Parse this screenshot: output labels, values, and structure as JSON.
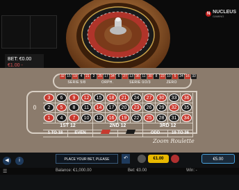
{
  "logo": {
    "name": "NUCLEUS",
    "sub": "GAMING"
  },
  "bet_panel": {
    "bet": "BET: €0.00",
    "limits": "€1.00 - €100.00"
  },
  "racetrack": {
    "numbers": [
      {
        "n": "32",
        "c": "red"
      },
      {
        "n": "15",
        "c": "black"
      },
      {
        "n": "19",
        "c": "red"
      },
      {
        "n": "4",
        "c": "black"
      },
      {
        "n": "21",
        "c": "red"
      },
      {
        "n": "2",
        "c": "black"
      },
      {
        "n": "25",
        "c": "red"
      },
      {
        "n": "17",
        "c": "black"
      },
      {
        "n": "34",
        "c": "red"
      },
      {
        "n": "6",
        "c": "black"
      },
      {
        "n": "27",
        "c": "red"
      },
      {
        "n": "13",
        "c": "black"
      },
      {
        "n": "36",
        "c": "red"
      },
      {
        "n": "11",
        "c": "black"
      },
      {
        "n": "30",
        "c": "red"
      },
      {
        "n": "8",
        "c": "black"
      },
      {
        "n": "23",
        "c": "red"
      },
      {
        "n": "10",
        "c": "black"
      },
      {
        "n": "5",
        "c": "red"
      },
      {
        "n": "24",
        "c": "black"
      },
      {
        "n": "16",
        "c": "red"
      },
      {
        "n": "33",
        "c": "black"
      }
    ],
    "sectors": [
      "SERIE 5/8",
      "ORPH.",
      "SERIE 0/2/3",
      "ZERO"
    ]
  },
  "table": {
    "zero": "0",
    "rows": [
      [
        {
          "n": "3",
          "c": "red"
        },
        {
          "n": "6",
          "c": "black"
        },
        {
          "n": "9",
          "c": "red"
        },
        {
          "n": "12",
          "c": "red"
        },
        {
          "n": "15",
          "c": "black"
        },
        {
          "n": "18",
          "c": "red"
        },
        {
          "n": "21",
          "c": "red"
        },
        {
          "n": "24",
          "c": "black"
        },
        {
          "n": "27",
          "c": "red"
        },
        {
          "n": "30",
          "c": "red"
        },
        {
          "n": "33",
          "c": "black"
        },
        {
          "n": "36",
          "c": "red"
        }
      ],
      [
        {
          "n": "2",
          "c": "black"
        },
        {
          "n": "5",
          "c": "red"
        },
        {
          "n": "8",
          "c": "black"
        },
        {
          "n": "11",
          "c": "black"
        },
        {
          "n": "14",
          "c": "red"
        },
        {
          "n": "17",
          "c": "black"
        },
        {
          "n": "20",
          "c": "black"
        },
        {
          "n": "23",
          "c": "red"
        },
        {
          "n": "26",
          "c": "black"
        },
        {
          "n": "29",
          "c": "black"
        },
        {
          "n": "32",
          "c": "red"
        },
        {
          "n": "35",
          "c": "black"
        }
      ],
      [
        {
          "n": "1",
          "c": "red"
        },
        {
          "n": "4",
          "c": "black"
        },
        {
          "n": "7",
          "c": "red"
        },
        {
          "n": "10",
          "c": "black"
        },
        {
          "n": "13",
          "c": "black"
        },
        {
          "n": "16",
          "c": "red"
        },
        {
          "n": "19",
          "c": "red"
        },
        {
          "n": "22",
          "c": "black"
        },
        {
          "n": "25",
          "c": "red"
        },
        {
          "n": "28",
          "c": "black"
        },
        {
          "n": "31",
          "c": "black"
        },
        {
          "n": "34",
          "c": "red"
        }
      ]
    ],
    "dozens": [
      "1ST 12",
      "2ND 12",
      "3RD 12"
    ],
    "outside": [
      "1 TO 18",
      "EVEN",
      "",
      "",
      "ODD",
      "19 TO 36"
    ]
  },
  "brand_text": "Zoom Roulette",
  "controls": {
    "message": "PLACE YOUR BET, PLEASE",
    "chip_selected": "€1.00",
    "cash": "€5.00"
  },
  "status": {
    "balance": "Balance: €1,000.00",
    "bet": "Bet: €0.00",
    "win": "Win: -"
  },
  "colors": {
    "felt": "#8b7b6c",
    "red": "#c73a2f",
    "black": "#1a1a1a",
    "accent": "#e8b800"
  }
}
